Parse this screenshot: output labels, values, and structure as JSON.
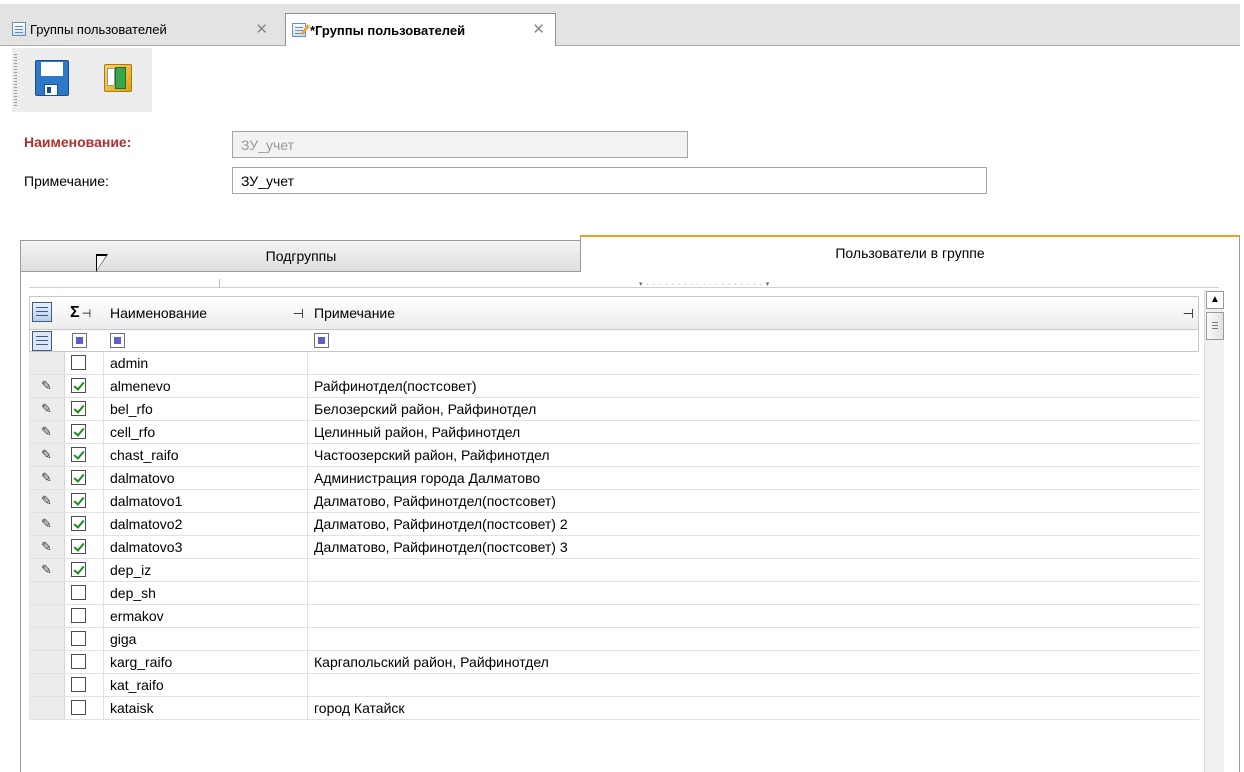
{
  "tabs": [
    {
      "label": "Группы пользователей",
      "active": false
    },
    {
      "label": "*Группы пользователей",
      "active": true
    }
  ],
  "toolbar": {
    "save_icon": "save-icon",
    "exit_icon": "exit-icon"
  },
  "form": {
    "name_label": "Наименование:",
    "name_value": "ЗУ_учет",
    "note_label": "Примечание:",
    "note_value": "ЗУ_учет"
  },
  "inner_tabs": [
    {
      "label": "Подгруппы",
      "active": false
    },
    {
      "label": "Пользователи в группе",
      "active": true
    }
  ],
  "grid": {
    "sum_symbol": "Σ",
    "pin_symbol": "⊣",
    "columns": [
      "Наименование",
      "Примечание"
    ],
    "rows": [
      {
        "checked": false,
        "name": "admin",
        "note": "",
        "edited": false
      },
      {
        "checked": true,
        "name": "almenevo",
        "note": "Райфинотдел(постсовет)",
        "edited": true
      },
      {
        "checked": true,
        "name": "bel_rfo",
        "note": "Белозерский район, Райфинотдел",
        "edited": true
      },
      {
        "checked": true,
        "name": "cell_rfo",
        "note": "Целинный район, Райфинотдел",
        "edited": true
      },
      {
        "checked": true,
        "name": "chast_raifo",
        "note": "Частоозерский район, Райфинотдел",
        "edited": true
      },
      {
        "checked": true,
        "name": "dalmatovo",
        "note": "Администрация города Далматово",
        "edited": true
      },
      {
        "checked": true,
        "name": "dalmatovo1",
        "note": "Далматово, Райфинотдел(постсовет)",
        "edited": true
      },
      {
        "checked": true,
        "name": "dalmatovo2",
        "note": "Далматово, Райфинотдел(постсовет) 2",
        "edited": true
      },
      {
        "checked": true,
        "name": "dalmatovo3",
        "note": "Далматово, Райфинотдел(постсовет) 3",
        "edited": true
      },
      {
        "checked": true,
        "name": "dep_iz",
        "note": "",
        "edited": true
      },
      {
        "checked": false,
        "name": "dep_sh",
        "note": "",
        "edited": false
      },
      {
        "checked": false,
        "name": "ermakov",
        "note": "",
        "edited": false
      },
      {
        "checked": false,
        "name": "giga",
        "note": "",
        "edited": false
      },
      {
        "checked": false,
        "name": "karg_raifo",
        "note": "Каргапольский район, Райфинотдел",
        "edited": false
      },
      {
        "checked": false,
        "name": "kat_raifo",
        "note": "",
        "edited": false
      },
      {
        "checked": false,
        "name": "kataisk",
        "note": "город Катайск",
        "edited": false
      }
    ]
  }
}
